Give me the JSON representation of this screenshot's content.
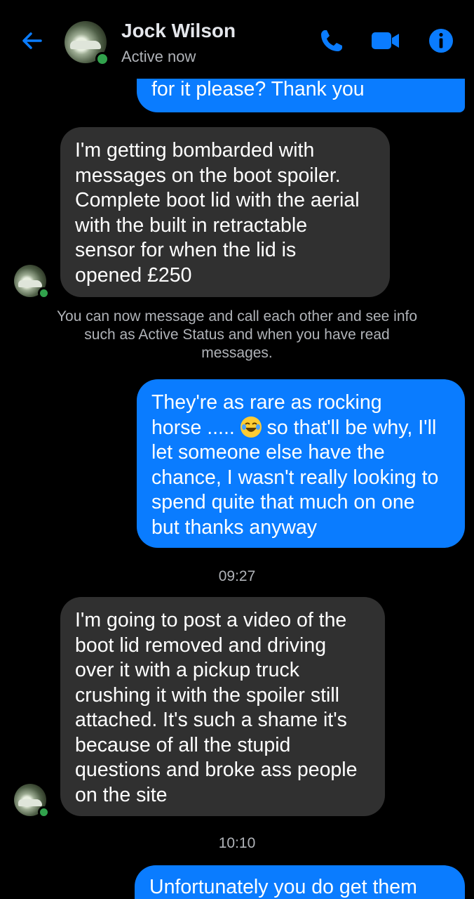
{
  "header": {
    "contact_name": "Jock Wilson",
    "status": "Active now"
  },
  "messages": [
    {
      "lines": [
        "for it please? Thank you"
      ]
    },
    {
      "lines": [
        "I'm getting bombarded with",
        "messages on the boot spoiler.",
        "Complete boot lid with the aerial",
        "with the built in retractable",
        "sensor for when the lid is",
        "opened £250"
      ]
    },
    {
      "lines": [
        "They're as rare as rocking",
        "horse ..... ",
        " so that'll be why, I'll",
        "let someone else have the",
        "chance, I wasn't really looking to",
        "spend quite that much on one",
        "but thanks anyway"
      ]
    },
    {
      "lines": [
        "I'm going to post a video of the",
        "boot lid removed and driving",
        "over it with a pickup truck",
        "crushing it with the spoiler still",
        "attached. It's such a shame it's",
        "because of all the stupid",
        "questions and broke ass people",
        "on the site"
      ]
    },
    {
      "lines": [
        "Unfortunately you do get them"
      ]
    }
  ],
  "notice": "You can now message and call each other and see info such as Active Status and when you have read messages.",
  "timestamps": [
    "09:27",
    "10:10"
  ],
  "colors": {
    "outgoing_bubble": "#0a7cff",
    "incoming_bubble": "#303030",
    "accent": "#0a7cff",
    "online": "#31a24c"
  },
  "icons": [
    "back-arrow-icon",
    "phone-icon",
    "video-camera-icon",
    "info-icon",
    "laughing-emoji-icon"
  ]
}
